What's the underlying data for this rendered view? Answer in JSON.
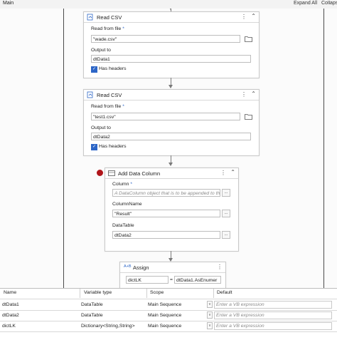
{
  "header": {
    "main_label": "Main",
    "expand_all": "Expand All",
    "collapse_all": "Collapse All"
  },
  "activities": {
    "read_csv_1": {
      "title": "Read CSV",
      "read_from_label": "Read from file",
      "required_mark": "*",
      "read_from_value": "\"wade.csv\"",
      "output_label": "Output to",
      "output_value": "dtData1",
      "has_headers_label": "Has headers",
      "has_headers_checked": true
    },
    "read_csv_2": {
      "title": "Read CSV",
      "read_from_label": "Read from file",
      "required_mark": "*",
      "read_from_value": "\"test1.csv\"",
      "output_label": "Output to",
      "output_value": "dtData2",
      "has_headers_label": "Has headers",
      "has_headers_checked": true
    },
    "add_data_column": {
      "title": "Add Data Column",
      "column_label": "Column",
      "required_mark": "*",
      "column_placeholder": "A DataColumn object that is to be appended to the",
      "column_name_label": "ColumnName",
      "column_name_value": "\"Result\"",
      "datatable_label": "DataTable",
      "datatable_value": "dtData2",
      "ellipsis": "..."
    },
    "assign": {
      "title": "Assign",
      "icon_text": "A+B",
      "to_value": "dictLK",
      "equals": "=",
      "value_value": "dtData1.AsEnumer"
    }
  },
  "variables": {
    "columns": [
      "Name",
      "Variable type",
      "Scope",
      "Default"
    ],
    "rows": [
      {
        "name": "dtData1",
        "type": "DataTable",
        "scope": "Main Sequence",
        "default_placeholder": "Enter a VB expression"
      },
      {
        "name": "dtData2",
        "type": "DataTable",
        "scope": "Main Sequence",
        "default_placeholder": "Enter a VB expression"
      },
      {
        "name": "dictLK",
        "type": "Dictionary<String,String>",
        "scope": "Main Sequence",
        "default_placeholder": "Enter a VB expression"
      }
    ],
    "dropdown_glyph": "v"
  },
  "colors": {
    "accent": "#2d66c7",
    "breakpoint": "#b0151a"
  }
}
